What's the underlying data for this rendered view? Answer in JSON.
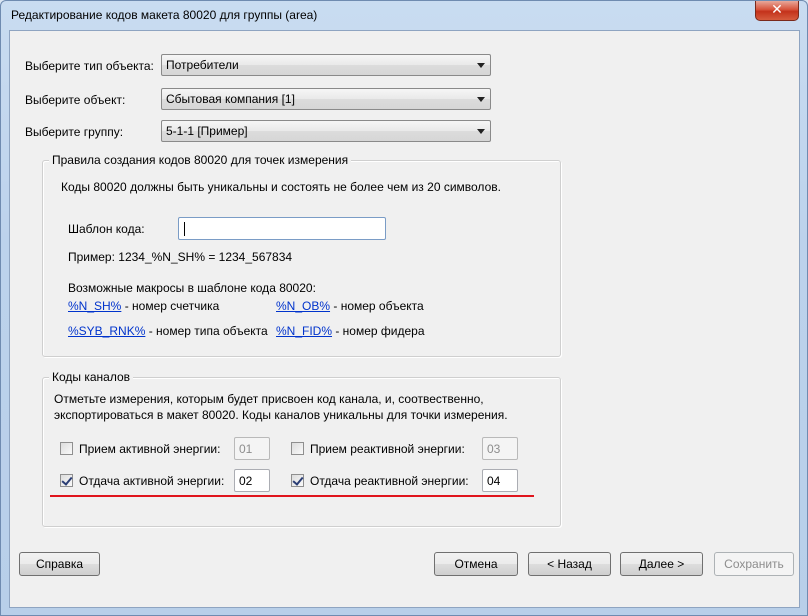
{
  "window": {
    "title": "Редактирование кодов макета 80020 для группы (area)",
    "close_symbol": "✕"
  },
  "form": {
    "object_type": {
      "label": "Выберите тип объекта:",
      "value": "Потребители"
    },
    "object": {
      "label": "Выберите объект:",
      "value": "Сбытовая компания [1]"
    },
    "group": {
      "label": "Выберите группу:",
      "value": "5-1-1 [Пример]"
    }
  },
  "rules": {
    "legend": "Правила создания кодов 80020 для точек измерения",
    "description": "Коды 80020 должны быть уникальны и состоять не более чем из 20 символов.",
    "template_label": "Шаблон кода:",
    "template_value": "",
    "example": "Пример: 1234_%N_SH% = 1234_567834",
    "macros_title": "Возможные макросы в шаблоне кода 80020:",
    "macros": [
      {
        "code": "%N_SH%",
        "desc": " - номер счетчика"
      },
      {
        "code": "%N_OB%",
        "desc": " - номер объекта"
      },
      {
        "code": "%SYB_RNK%",
        "desc": " - номер типа объекта"
      },
      {
        "code": "%N_FID%",
        "desc": " - номер фидера"
      }
    ]
  },
  "channels": {
    "legend": "Коды каналов",
    "description_1": "Отметьте измерения, которым будет присвоен код канала, и, соотвественно,",
    "description_2": "экспортироваться в макет 80020. Коды каналов уникальны для точки измерения.",
    "items": [
      {
        "label": "Прием активной энергии:",
        "checked": false,
        "value": "01"
      },
      {
        "label": "Прием реактивной энергии:",
        "checked": false,
        "value": "03"
      },
      {
        "label": "Отдача активной энергии:",
        "checked": true,
        "value": "02"
      },
      {
        "label": "Отдача реактивной энергии:",
        "checked": true,
        "value": "04"
      }
    ]
  },
  "buttons": {
    "help": "Справка",
    "cancel": "Отмена",
    "back": "< Назад",
    "next": "Далее >",
    "save": "Сохранить"
  },
  "colors": {
    "annotation_line": "#e0141c",
    "link": "#0033cc"
  }
}
